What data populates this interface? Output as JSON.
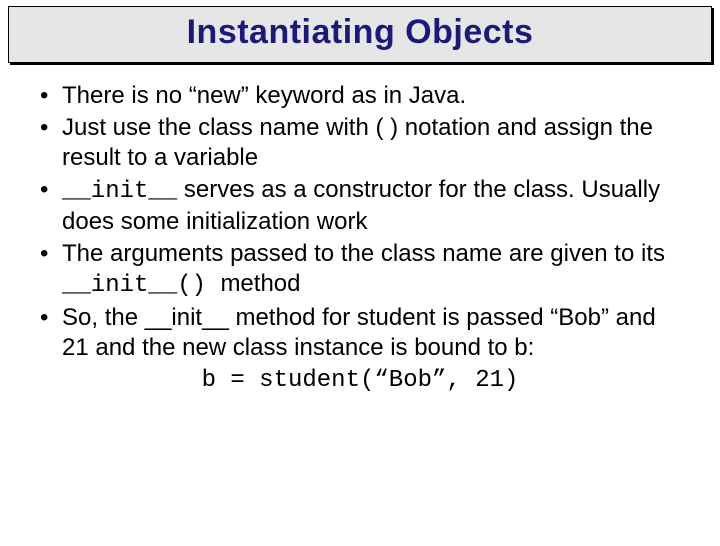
{
  "title": "Instantiating Objects",
  "bullets": {
    "b1": "There is no “new” keyword as in Java.",
    "b2": "Just use the class name with ( ) notation and assign the result to a variable",
    "b3_code": "__init__",
    "b3_rest": " serves as a constructor for the class. Usually does some initialization work",
    "b4_a": "The arguments passed to the class name are given to its ",
    "b4_code": " __init__() ",
    "b4_b": " method",
    "b5": "So, the __init__ method for student is passed “Bob” and 21 and the new class instance is bound to b:"
  },
  "code_line": "b = student(“Bob”, 21)"
}
